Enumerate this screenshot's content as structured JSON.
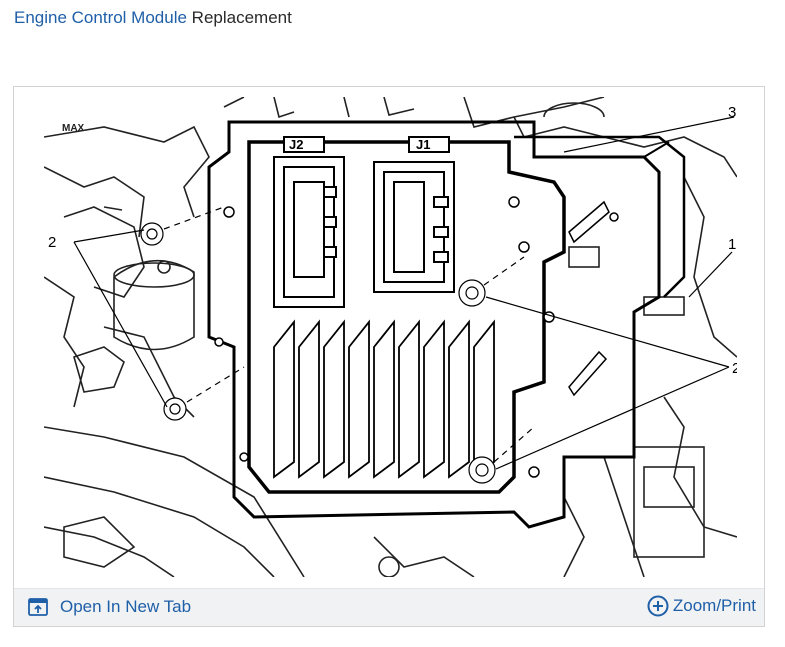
{
  "header": {
    "title_link": "Engine Control Module",
    "title_rest": " Replacement"
  },
  "figure": {
    "callouts": {
      "c1": "1",
      "c2_left": "2",
      "c2_right": "2",
      "c3": "3"
    },
    "connector_labels": {
      "j2": "J2",
      "j1": "J1"
    },
    "sticker_text": "MAX"
  },
  "footer": {
    "open_tab_label": "Open In New Tab",
    "open_tab_icon": "open-in-new-tab-icon",
    "zoom_label": "Zoom/Print",
    "zoom_icon": "plus-circle-icon"
  },
  "colors": {
    "link": "#1f5fa8",
    "footer_bg": "#f1f2f4",
    "border": "#d3d3d3"
  }
}
